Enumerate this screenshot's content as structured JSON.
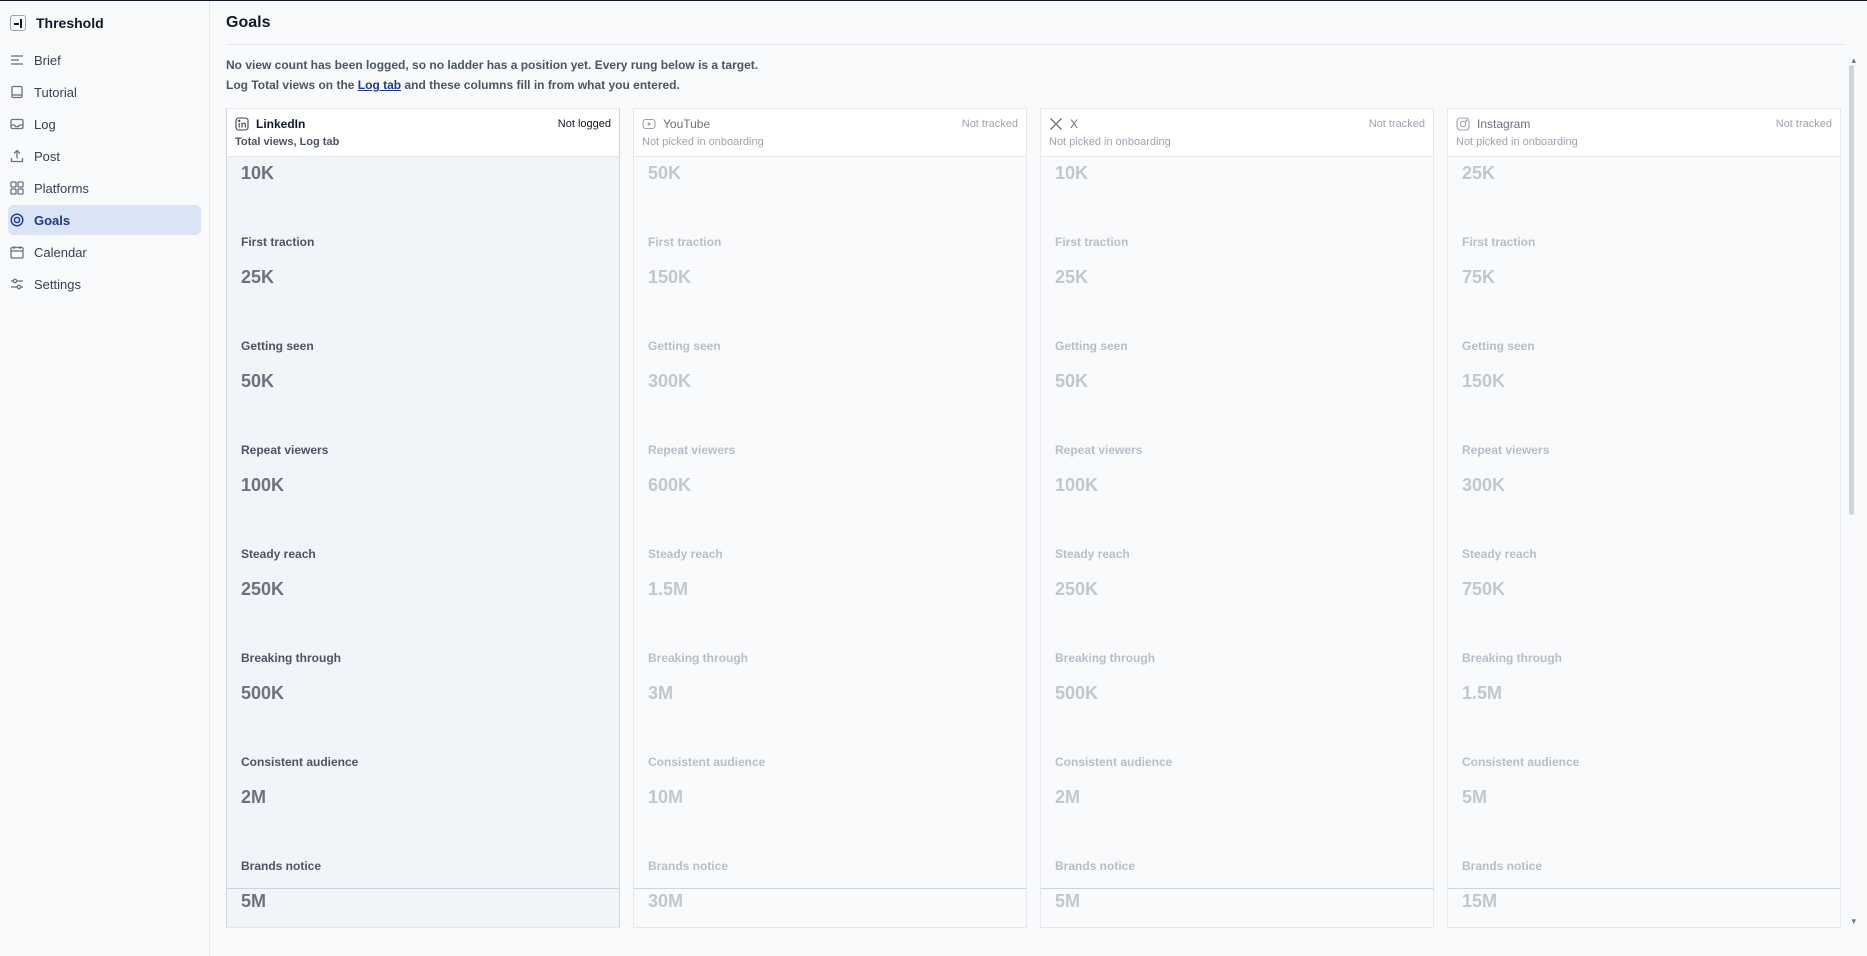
{
  "app": {
    "title": "Threshold"
  },
  "sidebar": {
    "items": [
      {
        "label": "Brief",
        "icon": "lines-icon",
        "active": false
      },
      {
        "label": "Tutorial",
        "icon": "book-icon",
        "active": false
      },
      {
        "label": "Log",
        "icon": "inbox-icon",
        "active": false
      },
      {
        "label": "Post",
        "icon": "upload-icon",
        "active": false
      },
      {
        "label": "Platforms",
        "icon": "grid-icon",
        "active": false
      },
      {
        "label": "Goals",
        "icon": "target-icon",
        "active": true
      },
      {
        "label": "Calendar",
        "icon": "calendar-icon",
        "active": false
      },
      {
        "label": "Settings",
        "icon": "sliders-icon",
        "active": false
      }
    ]
  },
  "page": {
    "title": "Goals",
    "intro_line1": "No view count has been logged, so no ladder has a position yet. Every rung below is a target.",
    "intro_line2_pre": "Log Total views on the ",
    "intro_link": "Log tab",
    "intro_line2_post": " and these columns fill in from what you entered."
  },
  "colors": {
    "accent": "#1e3a8a",
    "active_bg": "#dbe3f7",
    "linkedin_top": "#1e40af",
    "youtube_top": "#f2b8b8",
    "x_top": "#9ca3af",
    "instagram_top": "#f2b8b8"
  },
  "rung_labels": [
    "First traction",
    "Getting seen",
    "Repeat viewers",
    "Steady reach",
    "Breaking through",
    "Consistent audience",
    "Brands notice"
  ],
  "columns": [
    {
      "name": "LinkedIn",
      "icon": "linkedin-icon",
      "status": "Not logged",
      "sub": "Total views, Log tab",
      "tracked": true,
      "values": [
        "10K",
        "25K",
        "50K",
        "100K",
        "250K",
        "500K",
        "2M",
        "5M"
      ]
    },
    {
      "name": "YouTube",
      "icon": "youtube-icon",
      "status": "Not tracked",
      "sub": "Not picked in onboarding",
      "tracked": false,
      "values": [
        "50K",
        "150K",
        "300K",
        "600K",
        "1.5M",
        "3M",
        "10M",
        "30M"
      ]
    },
    {
      "name": "X",
      "icon": "x-icon",
      "status": "Not tracked",
      "sub": "Not picked in onboarding",
      "tracked": false,
      "values": [
        "10K",
        "25K",
        "50K",
        "100K",
        "250K",
        "500K",
        "2M",
        "5M"
      ]
    },
    {
      "name": "Instagram",
      "icon": "instagram-icon",
      "status": "Not tracked",
      "sub": "Not picked in onboarding",
      "tracked": false,
      "values": [
        "25K",
        "75K",
        "150K",
        "300K",
        "750K",
        "1.5M",
        "5M",
        "15M"
      ]
    }
  ]
}
